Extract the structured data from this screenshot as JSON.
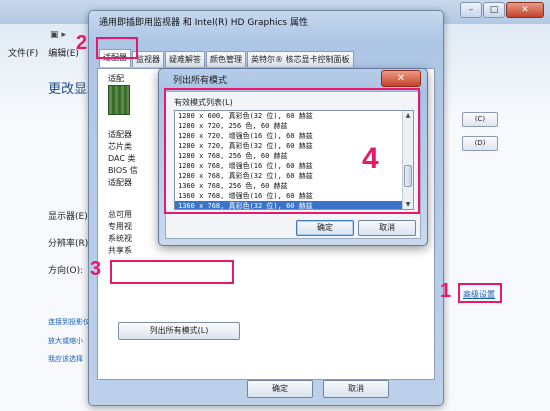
{
  "background_window": {
    "menu": [
      "文件(F)",
      "编辑(E)"
    ],
    "heading": "更改显示",
    "labels": [
      {
        "key": "display",
        "text": "显示器(E):"
      },
      {
        "key": "resolution",
        "text": "分辨率(R):"
      },
      {
        "key": "orientation",
        "text": "方向(O):"
      }
    ],
    "links": [
      "连接到投影仪",
      "放大或缩小",
      "我应该选择"
    ],
    "advanced_settings": "高级设置",
    "right_buttons": [
      "(C)",
      "(D)"
    ],
    "window_controls": {
      "minimize": "–",
      "maximize": "□",
      "close": "✕"
    }
  },
  "properties_dialog": {
    "title": "通用即插即用监视器 和 Intel(R) HD Graphics 属性",
    "tabs": [
      "适配器",
      "监视器",
      "疑难解答",
      "颜色管理",
      "英特尔® 核芯显卡控制面板"
    ],
    "card_label": "适配",
    "info_rows": [
      "适配器",
      "芯片类",
      "DAC 类",
      "BIOS 信",
      "适配器"
    ],
    "memory_rows": [
      "总可用",
      "专用视",
      "系统视",
      "共享系"
    ],
    "list_all_modes_button": "列出所有模式(L)",
    "ok": "确定",
    "cancel": "取消"
  },
  "modes_dialog": {
    "title": "列出所有模式",
    "close": "✕",
    "group_label": "有效模式列表(L)",
    "modes": [
      "1280 x 600, 真彩色(32 位), 60 赫兹",
      "1280 x 720, 256 色, 60 赫兹",
      "1280 x 720, 增强色(16 位), 60 赫兹",
      "1280 x 720, 真彩色(32 位), 60 赫兹",
      "1280 x 768, 256 色, 60 赫兹",
      "1280 x 768, 增强色(16 位), 60 赫兹",
      "1280 x 768, 真彩色(32 位), 60 赫兹",
      "1360 x 768, 256 色, 60 赫兹",
      "1360 x 768, 增强色(16 位), 60 赫兹",
      "1360 x 768, 真彩色(32 位), 60 赫兹"
    ],
    "selected_index": 9,
    "ok": "确定",
    "cancel": "取消"
  },
  "annotations": {
    "step1": "1",
    "step2": "2",
    "step3": "3",
    "step4": "4"
  },
  "colors": {
    "annotation": "#e8186b",
    "selection": "#3a73c9"
  }
}
